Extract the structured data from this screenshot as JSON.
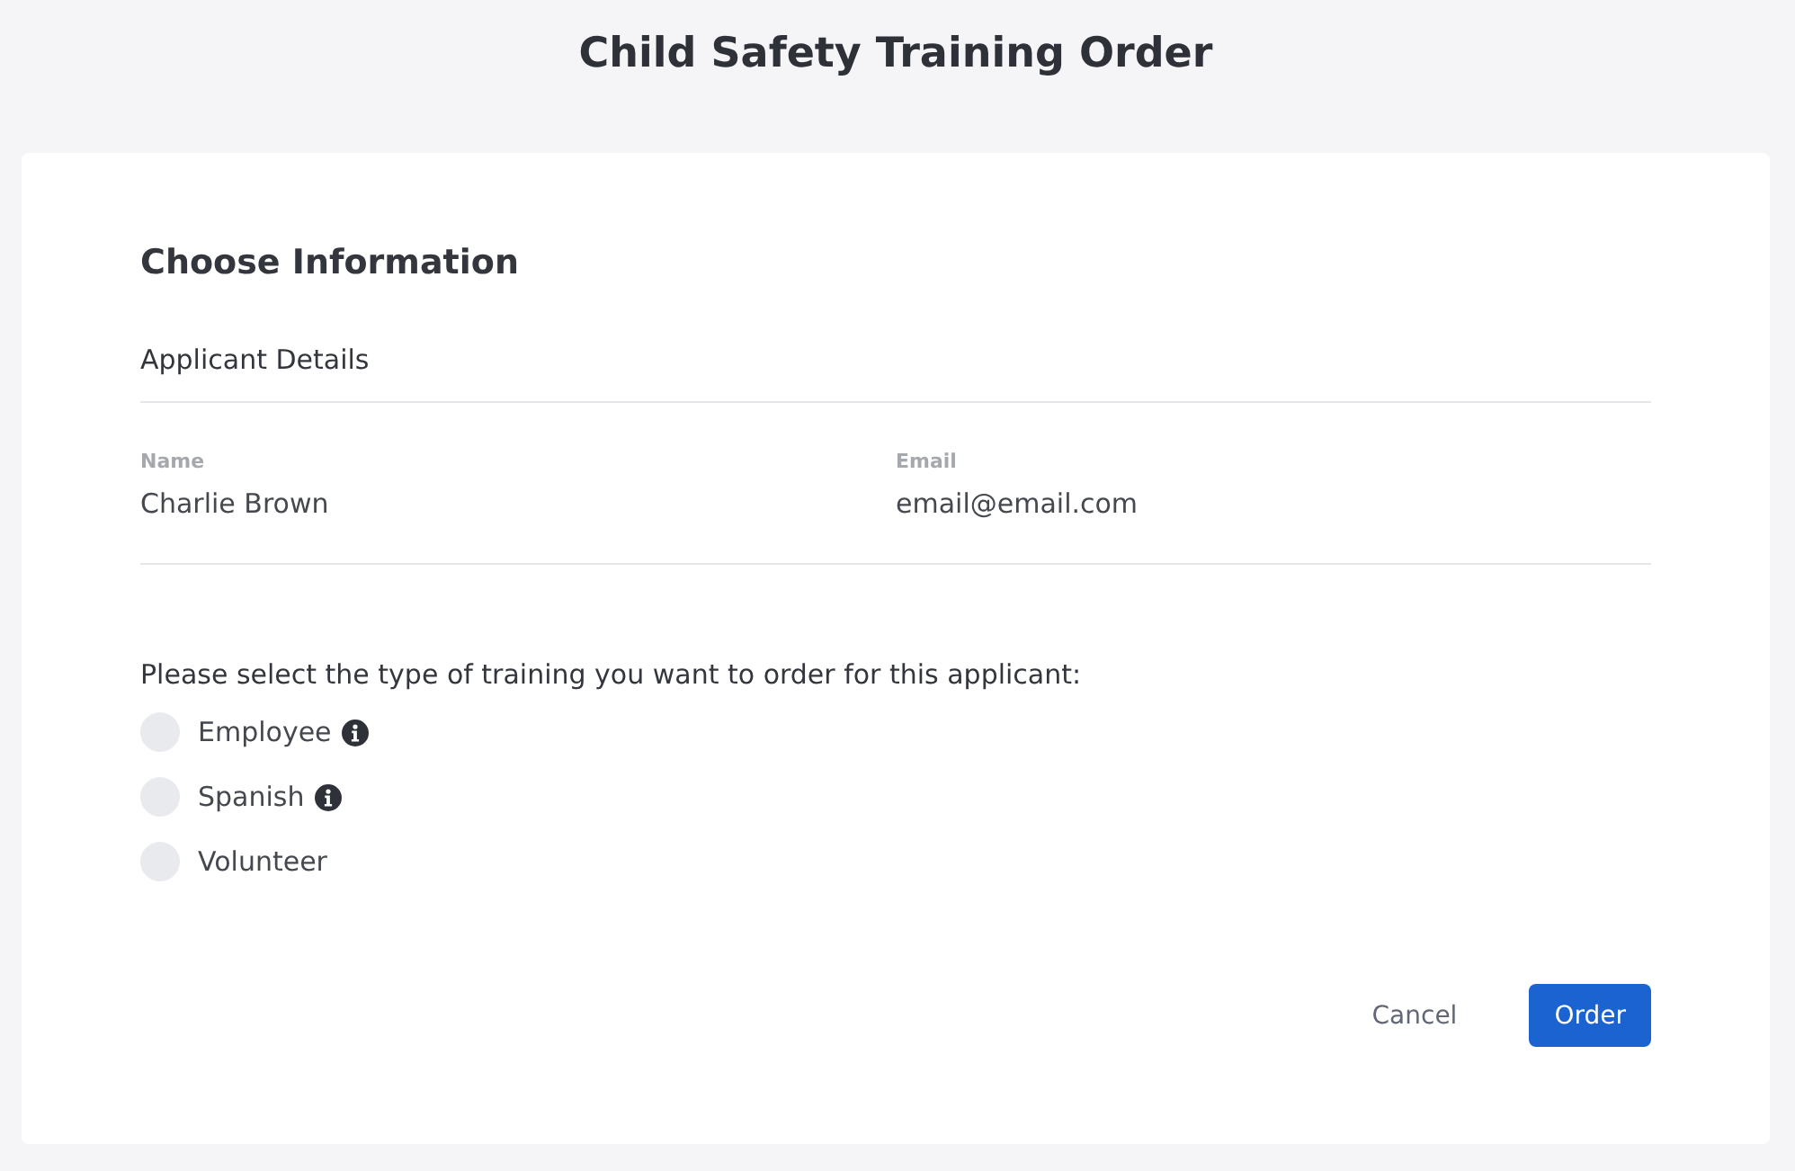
{
  "page_title": "Child Safety Training Order",
  "section_title": "Choose Information",
  "subsection_title": "Applicant Details",
  "fields": [
    {
      "label": "Name",
      "value": "Charlie Brown"
    },
    {
      "label": "Email",
      "value": "email@email.com"
    }
  ],
  "question": "Please select the type of training you want to order for this applicant:",
  "options": [
    {
      "label": "Employee",
      "selected": false,
      "info": true
    },
    {
      "label": "Spanish",
      "selected": false,
      "info": true
    },
    {
      "label": "Volunteer",
      "selected": false,
      "info": false
    }
  ],
  "buttons": [
    {
      "label": "Cancel",
      "kind": "secondary"
    },
    {
      "label": "Order",
      "kind": "primary"
    }
  ]
}
